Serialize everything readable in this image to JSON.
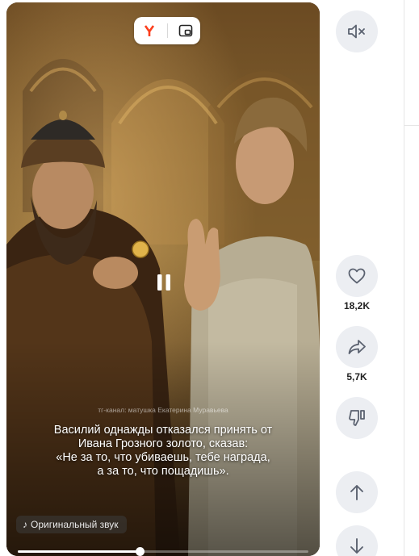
{
  "overlay": {
    "channel": "тг-канал: матушка Екатерина Муравьева",
    "caption_lines": [
      "Василий однажды отказался принять от",
      "Ивана Грозного золото, сказав:",
      "«Не за то, что убиваешь, тебе награда,",
      "а за то, что пощадишь»."
    ],
    "sound_label": "Оригинальный звук"
  },
  "top_bar": {
    "yandex_icon": "yandex-logo-icon",
    "pip_icon": "picture-in-picture-icon"
  },
  "player": {
    "state_icon": "pause-icon",
    "progress": 0.42
  },
  "actions": {
    "mute_icon": "speaker-muted-icon",
    "like_count": "18,2K",
    "share_count": "5,7K",
    "dislike_icon": "thumbs-down-icon",
    "prev_icon": "arrow-up-icon",
    "next_icon": "arrow-down-icon"
  },
  "colors": {
    "rail_button_bg": "#eceef2",
    "icon_color": "#5b6270",
    "yandex_red": "#fc3f1d"
  }
}
